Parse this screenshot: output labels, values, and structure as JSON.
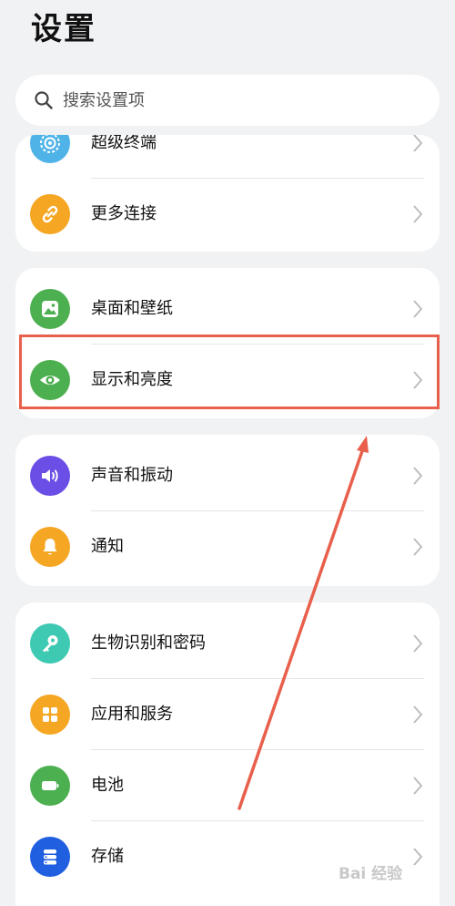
{
  "header": {
    "title": "设置"
  },
  "search": {
    "placeholder": "搜索设置项"
  },
  "groups": [
    {
      "items": [
        {
          "label": "超级终端",
          "icon": "super-device-icon",
          "color": "#4fb3e8"
        },
        {
          "label": "更多连接",
          "icon": "link-icon",
          "color": "#f5a623"
        }
      ]
    },
    {
      "items": [
        {
          "label": "桌面和壁纸",
          "icon": "wallpaper-icon",
          "color": "#4caf50"
        },
        {
          "label": "显示和亮度",
          "icon": "eye-icon",
          "color": "#4caf50"
        }
      ]
    },
    {
      "items": [
        {
          "label": "声音和振动",
          "icon": "speaker-icon",
          "color": "#6b4ee6"
        },
        {
          "label": "通知",
          "icon": "bell-icon",
          "color": "#f5a623"
        }
      ]
    },
    {
      "items": [
        {
          "label": "生物识别和密码",
          "icon": "key-icon",
          "color": "#3ec9b2"
        },
        {
          "label": "应用和服务",
          "icon": "apps-grid-icon",
          "color": "#f5a623"
        },
        {
          "label": "电池",
          "icon": "battery-icon",
          "color": "#4caf50"
        },
        {
          "label": "存储",
          "icon": "storage-icon",
          "color": "#1f5fe0"
        }
      ]
    }
  ],
  "annotation": {
    "highlight_color": "#e8604c"
  },
  "watermark": {
    "text": "Bai 经验"
  }
}
